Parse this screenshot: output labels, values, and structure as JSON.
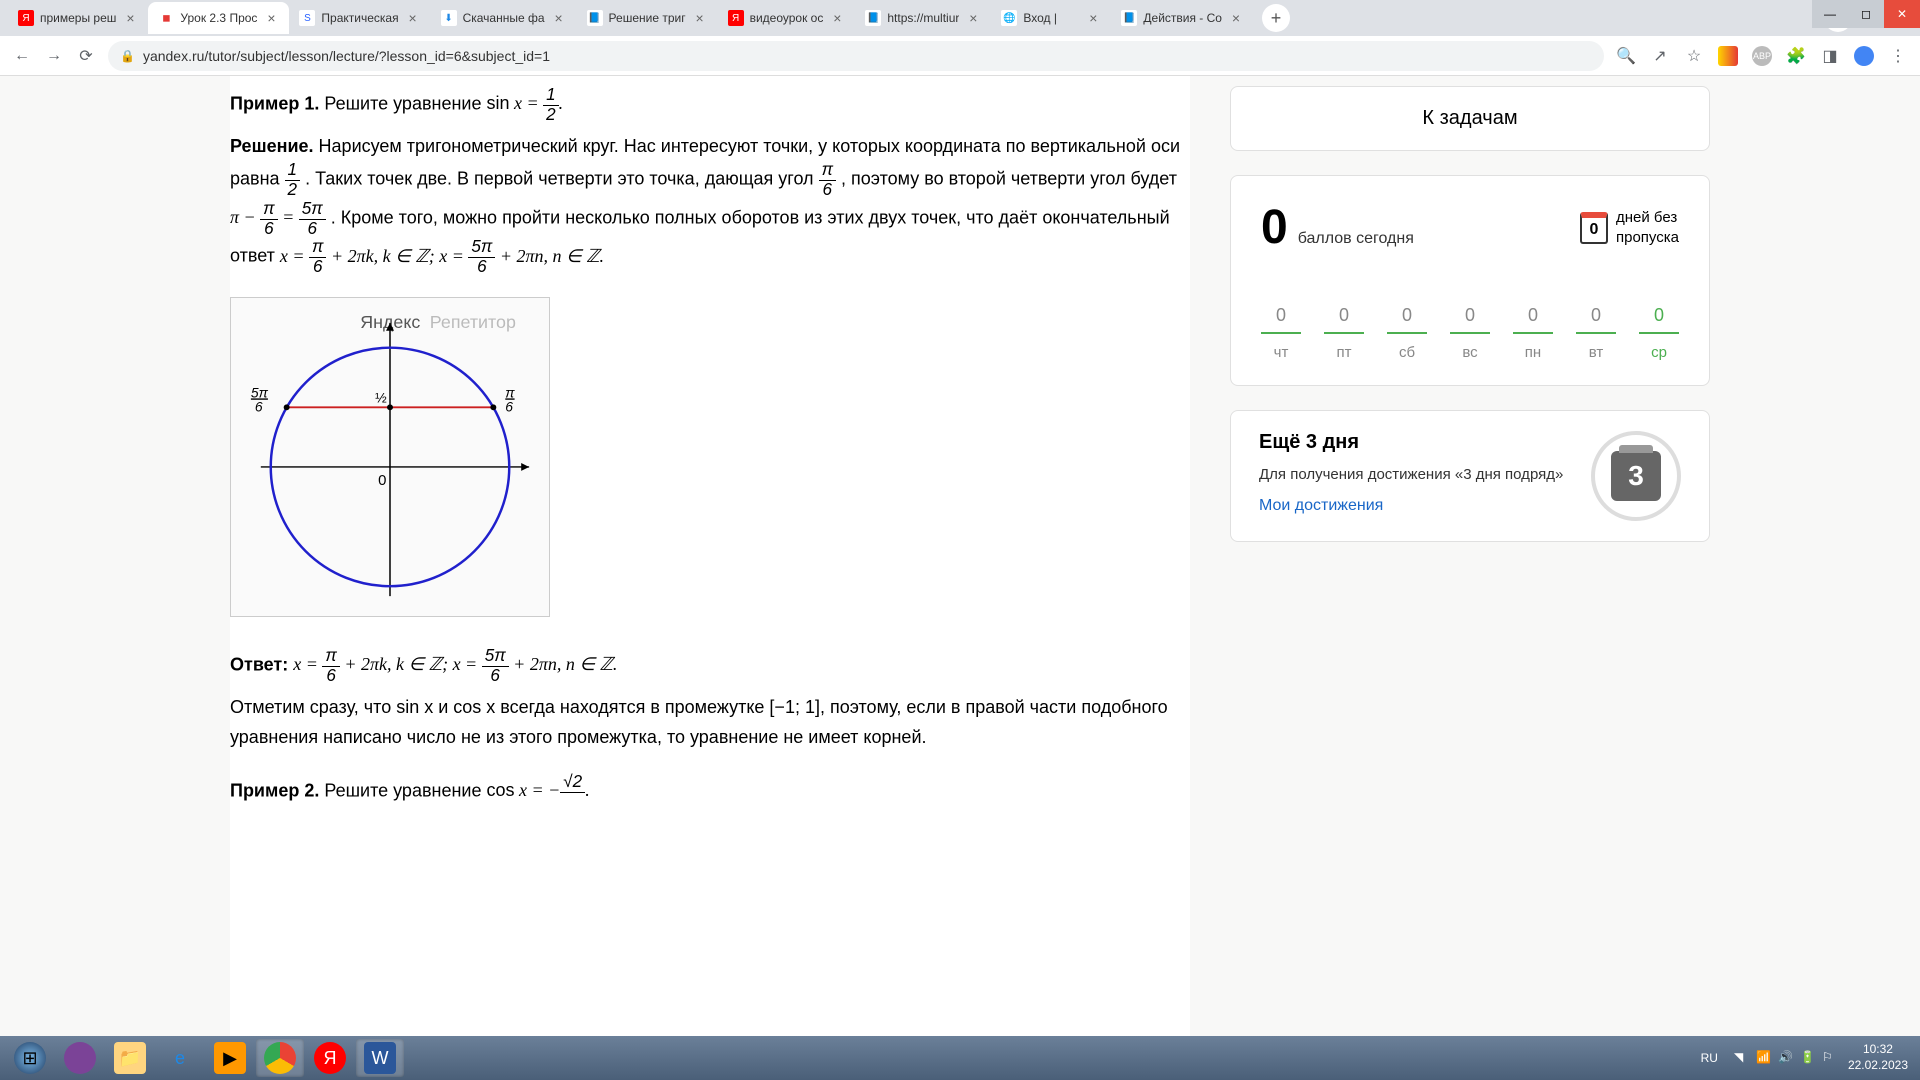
{
  "tabs": [
    {
      "title": "примеры реш",
      "favicon_bg": "#ff0000",
      "favicon_color": "#fff",
      "favicon_char": "Я"
    },
    {
      "title": "Урок 2.3 Прос",
      "favicon_bg": "#fff",
      "favicon_color": "#e53935",
      "favicon_char": "◼",
      "active": true
    },
    {
      "title": "Практическая",
      "favicon_bg": "#fff",
      "favicon_color": "#2962ff",
      "favicon_char": "S"
    },
    {
      "title": "Скачанные фа",
      "favicon_bg": "#fff",
      "favicon_color": "#1e88e5",
      "favicon_char": "⬇"
    },
    {
      "title": "Решение триг",
      "favicon_bg": "#fff",
      "favicon_color": "#1976d2",
      "favicon_char": "📘"
    },
    {
      "title": "видеоурок ос",
      "favicon_bg": "#ff0000",
      "favicon_color": "#fff",
      "favicon_char": "Я"
    },
    {
      "title": "https://multiur",
      "favicon_bg": "#fff",
      "favicon_color": "#1976d2",
      "favicon_char": "📘"
    },
    {
      "title": "Вход |",
      "favicon_bg": "#fff",
      "favicon_color": "#555",
      "favicon_char": "🌐"
    },
    {
      "title": "Действия - Со",
      "favicon_bg": "#fff",
      "favicon_color": "#1976d2",
      "favicon_char": "📘"
    }
  ],
  "url": "yandex.ru/tutor/subject/lesson/lecture/?lesson_id=6&subject_id=1",
  "content": {
    "ex1_label": "Пример 1.",
    "ex1_text": "Решите уравнение ",
    "sol_label": "Решение.",
    "sol_p1a": "Нарисуем тригонометрический круг. Нас интересуют точки, у которых координата по вертикальной оси равна ",
    "sol_p1b": ". Таких точек две. В первой четверти это точка, дающая угол ",
    "sol_p1c": ", поэтому во второй четверти угол будет ",
    "sol_p1d": ". Кроме того, можно пройти несколько полных оборотов из этих двух точек, что даёт окончательный ответ ",
    "watermark1": "Яндекс",
    "watermark2": "Репетитор",
    "ans_label": "Ответ:",
    "note": "Отметим сразу, что sin x и cos x всегда находятся в промежутке [−1; 1], поэтому, если в правой части подобного уравнения написано число не из этого промежутка, то уравнение не имеет корней.",
    "ex2_label": "Пример 2.",
    "ex2_text": "Решите уравнение "
  },
  "sidebar": {
    "to_tasks": "К задачам",
    "score_val": "0",
    "score_label": "баллов сегодня",
    "streak_val": "0",
    "streak_l1": "дней без",
    "streak_l2": "пропуска",
    "days": [
      {
        "val": "0",
        "name": "чт"
      },
      {
        "val": "0",
        "name": "пт"
      },
      {
        "val": "0",
        "name": "сб"
      },
      {
        "val": "0",
        "name": "вс"
      },
      {
        "val": "0",
        "name": "пн"
      },
      {
        "val": "0",
        "name": "вт"
      },
      {
        "val": "0",
        "name": "ср",
        "today": true
      }
    ],
    "achieve_title": "Ещё 3 дня",
    "achieve_desc": "Для получения достижения «3 дня подряд»",
    "achieve_link": "Мои достижения",
    "badge_num": "3"
  },
  "taskbar": {
    "lang": "RU",
    "time": "10:32",
    "date": "22.02.2023"
  }
}
